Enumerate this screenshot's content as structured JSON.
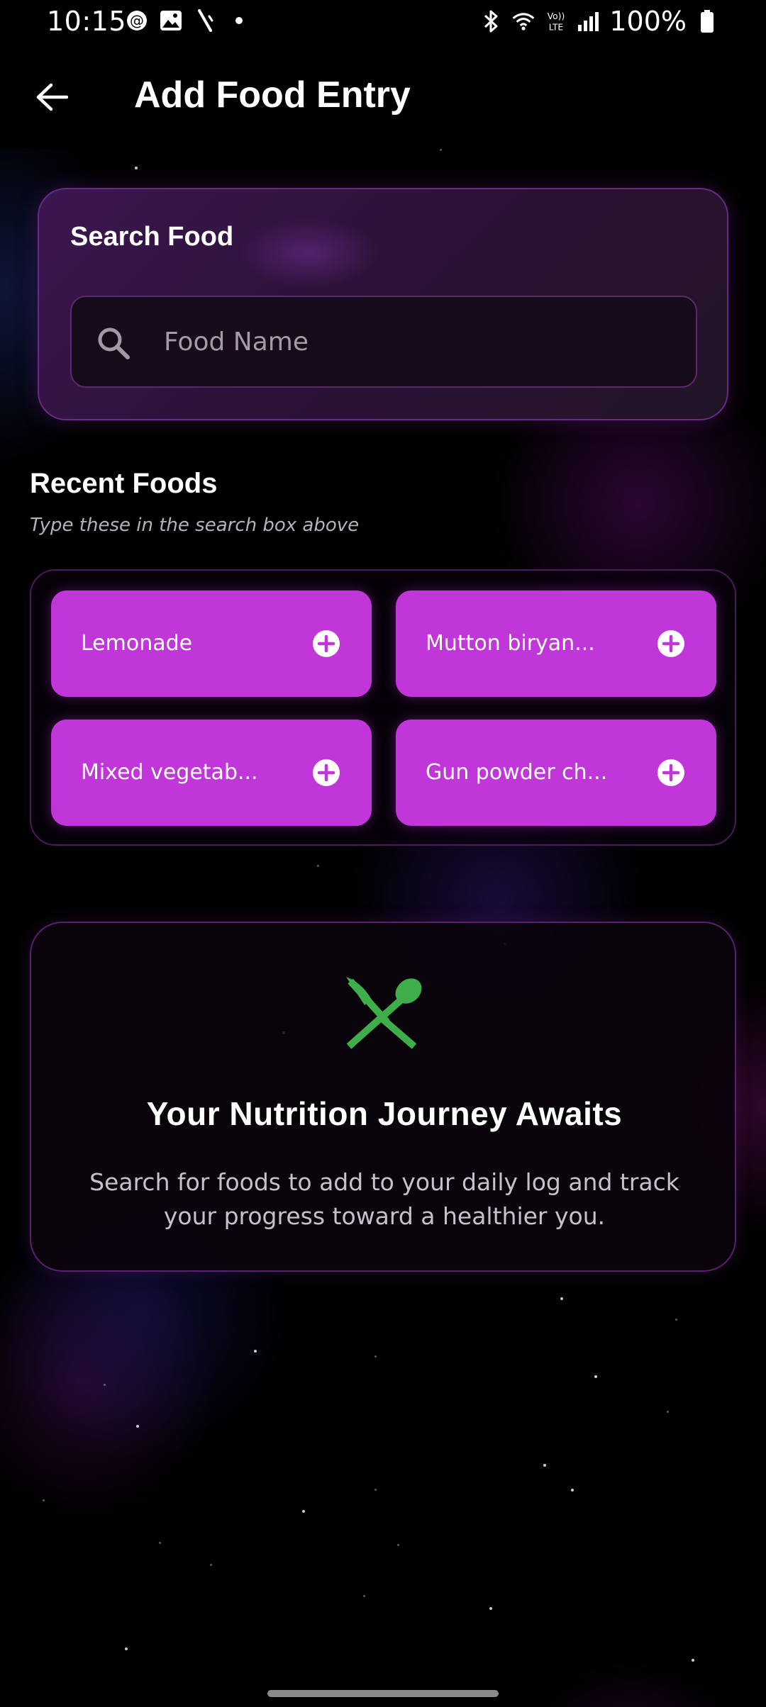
{
  "status_bar": {
    "time": "10:15",
    "battery": "100%",
    "left_icons": [
      "threads-icon",
      "gallery-icon",
      "slash-icon",
      "dot-icon"
    ],
    "right_icons": [
      "bluetooth-icon",
      "wifi-icon",
      "volte-icon",
      "signal-icon",
      "battery-icon"
    ]
  },
  "app_bar": {
    "title": "Add Food Entry"
  },
  "search": {
    "title": "Search Food",
    "placeholder": "Food Name",
    "value": ""
  },
  "recent": {
    "title": "Recent Foods",
    "subtitle": "Type these in the search box above",
    "items": [
      {
        "label": "Lemonade"
      },
      {
        "label": "Mutton biryan..."
      },
      {
        "label": "Mixed vegetab..."
      },
      {
        "label": "Gun powder ch..."
      }
    ]
  },
  "empty_state": {
    "icon": "utensils-icon",
    "title": "Your Nutrition Journey Awaits",
    "text": "Search for foods to add to your daily log and track your progress toward a healthier you."
  },
  "colors": {
    "accent": "#c136d8",
    "icon_green": "#3fae4a",
    "background": "#000000"
  }
}
